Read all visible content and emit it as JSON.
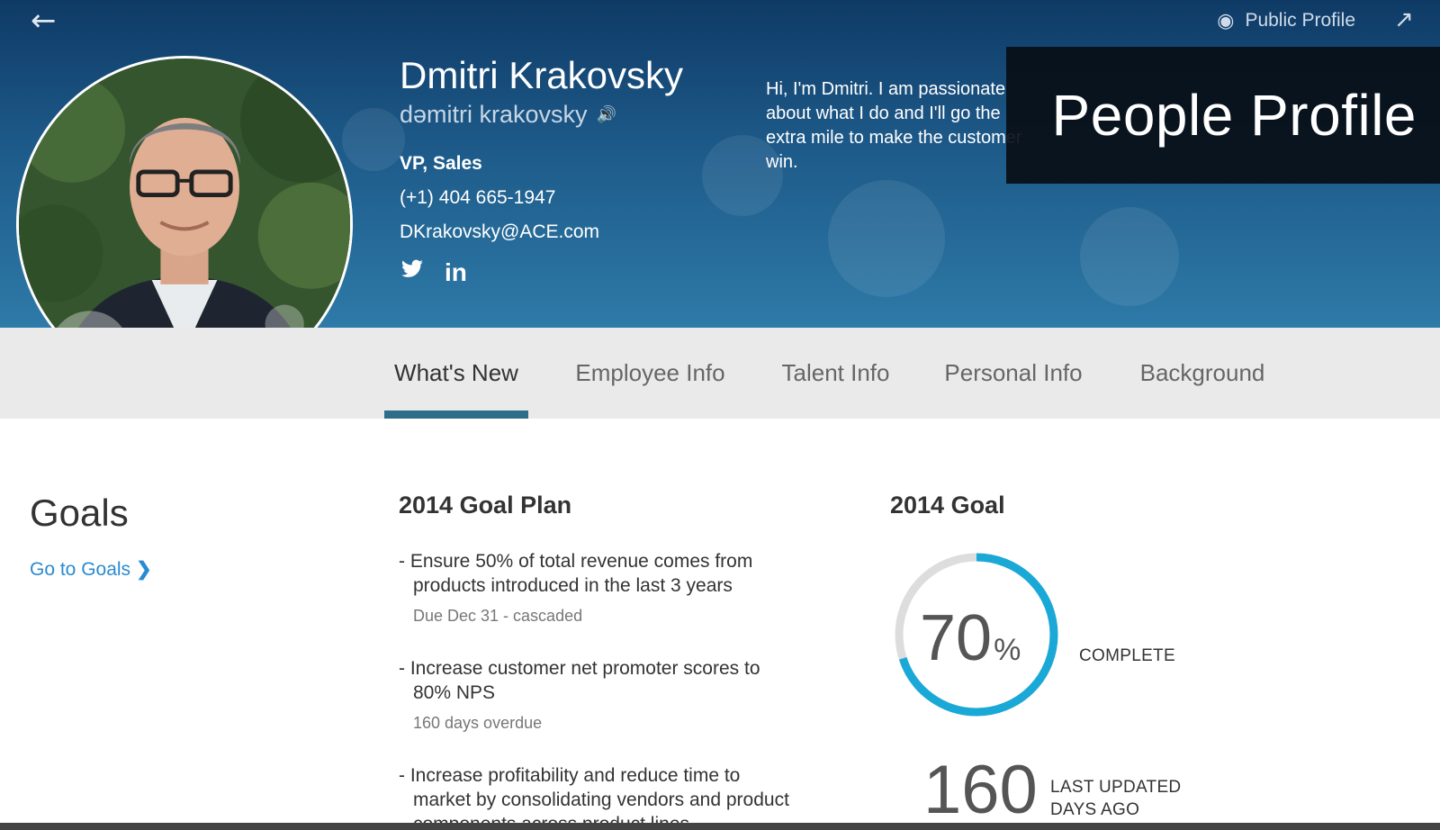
{
  "header": {
    "back_icon": "arrow-left-icon",
    "public_profile_label": "Public Profile",
    "share_icon": "share-icon",
    "name": "Dmitri Krakovsky",
    "phonetic": "dəmitri krakovsky",
    "job_title": "VP, Sales",
    "phone": "(+1) 404 665-1947",
    "email": "DKrakovsky@ACE.com",
    "social": [
      "twitter-icon",
      "linkedin-icon"
    ],
    "linkedin_label": "in",
    "bio": "Hi, I'm Dmitri. I am passionate about what I do and I'll go the extra mile to make the customer win.",
    "watermark": "People Profile"
  },
  "tabs": [
    {
      "label": "What's New",
      "active": true
    },
    {
      "label": "Employee Info",
      "active": false
    },
    {
      "label": "Talent Info",
      "active": false
    },
    {
      "label": "Personal Info",
      "active": false
    },
    {
      "label": "Background",
      "active": false
    }
  ],
  "goals": {
    "title": "Goals",
    "link_label": "Go to Goals",
    "link_chevron": "❯"
  },
  "goal_plan": {
    "title": "2014 Goal Plan",
    "items": [
      {
        "text": "- Ensure 50% of total revenue comes from products introduced in the last 3 years",
        "meta": "Due Dec 31 - cascaded"
      },
      {
        "text": "- Increase customer net promoter scores to 80% NPS",
        "meta": "160 days overdue"
      },
      {
        "text": "- Increase profitability and reduce time to market by consolidating vendors and product components across product lines",
        "meta": ""
      }
    ]
  },
  "goal_summary": {
    "title": "2014 Goal",
    "percent_value": "70",
    "percent_sign": "%",
    "progress": 0.7,
    "complete_label": "COMPLETE",
    "days_value": "160",
    "days_label_line1": "LAST UPDATED",
    "days_label_line2": "DAYS AGO",
    "ring_color": "#1aa8d6",
    "ring_track_color": "#dddddd"
  }
}
